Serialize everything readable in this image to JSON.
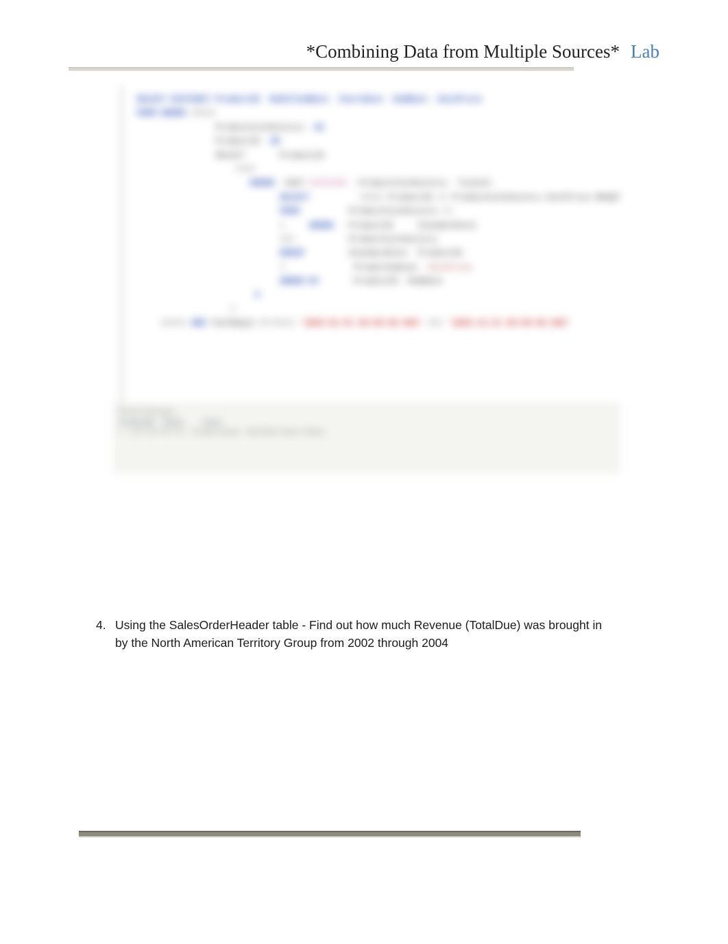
{
  "header": {
    "title": "*Combining Data from Multiple Sources*",
    "lab": "Lab"
  },
  "question": {
    "number": "4.",
    "text": "Using the SalesOrderHeader table - Find out how much Revenue (TotalDue) was brought in by the North American Territory Group from 2002 through 2004"
  },
  "code_tokens": {
    "l1_a": "SELECT",
    "l1_b": "DISTINCT",
    "l1_c": "ProductID",
    "l1_d": "ModifiedDate",
    "l1_e": "StartDate",
    "l1_f": "EndDate",
    "l1_g": "UnitPrice",
    "l2_a": "FROM",
    "l2_b": "WHERE",
    "l2_c": "ORDER",
    "l3_a": "ProductCostHistory",
    "l3_b": "AS",
    "l4_a": "ProductID",
    "l4_b": "IN",
    "l5_a": "SELECT",
    "l5_b": "ProductID",
    "l6_a": "FROM",
    "l7_a": "WHERE",
    "l7_b": "CAST",
    "l7_c": "DATEPART",
    "l7_d": "ProductCostHistory",
    "l7_e": "TinyInt",
    "l8_a": "SELECT",
    "l8_b": "INNER",
    "l8_c": "JOIN",
    "l8_d": "ProductID",
    "l8_e": "AS",
    "l8_f": "ProductCostHistory",
    "l8_g": "UnitPrice",
    "l8_h": "MAXQTY",
    "l9_a": "FROM",
    "l9_b": "ProductCostHistory",
    "l9_c": "AS",
    "l10_a": "WHERE",
    "l10_b": "ProductID",
    "l11_a": "AND",
    "l11_b": "YEAR",
    "l11_c": "StandardCost",
    "l12_a": "GROUP",
    "l12_b": "ProductCostHistory",
    "l13_a": "ORDER",
    "l13_b": "StandardCost",
    "l13_c": "ProductID",
    "l14_a": "ProductSubcat",
    "l14_b": "UnitPrice",
    "l15_a": "ORDER BY",
    "l15_b": "ProductID",
    "l15_c": "ModDate",
    "l16_a": "0",
    "l17_a": "0",
    "last_a": "WHERE",
    "last_b": "AND",
    "last_c": "YearBegin",
    "last_d": "BETWEEN",
    "last_e": "'2003-01-01 00:00:00.000'",
    "last_f": "AND",
    "last_g": "'2003-12-31 00:00:00.000'"
  },
  "results": {
    "tab_label": "Results  Messages",
    "row_label": "1",
    "col1": "ProductID",
    "col2": "Name",
    "col3": "Color",
    "val1": "710 715 716 717",
    "val2": "Product Name",
    "val3": "Red Blue Green Yellow"
  }
}
